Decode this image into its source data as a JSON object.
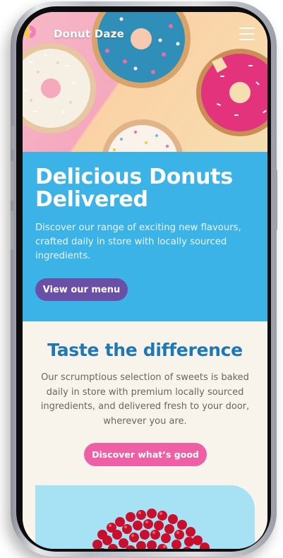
{
  "brand": {
    "name": "Donut Daze",
    "logo_icon": "donut-logo-icon",
    "logo_colors": [
      "#f9c744",
      "#f47fb3"
    ]
  },
  "nav": {
    "menu_icon": "hamburger-menu-icon"
  },
  "hero": {
    "image_icon": "donuts-hero-image"
  },
  "intro": {
    "headline": "Delicious Donuts Delivered",
    "description": "Discover our range of exciting new flavours, crafted daily in store with locally sourced ingredients.",
    "cta_label": "View our menu",
    "background_color": "#3bb3e6",
    "cta_color": "#6a4fa6"
  },
  "taste": {
    "title": "Taste the difference",
    "description": "Our scrumptious selection of sweets is baked daily in store with premium locally sourced ingredients, and delivered fresh to your door, wherever you are.",
    "cta_label": "Discover what’s good",
    "title_color": "#1e78b6",
    "cta_color": "#ef5fa6",
    "background_color": "#f8f4ec"
  },
  "feature_card": {
    "image_icon": "red-berries-image",
    "background_color": "#a6e2f4"
  }
}
